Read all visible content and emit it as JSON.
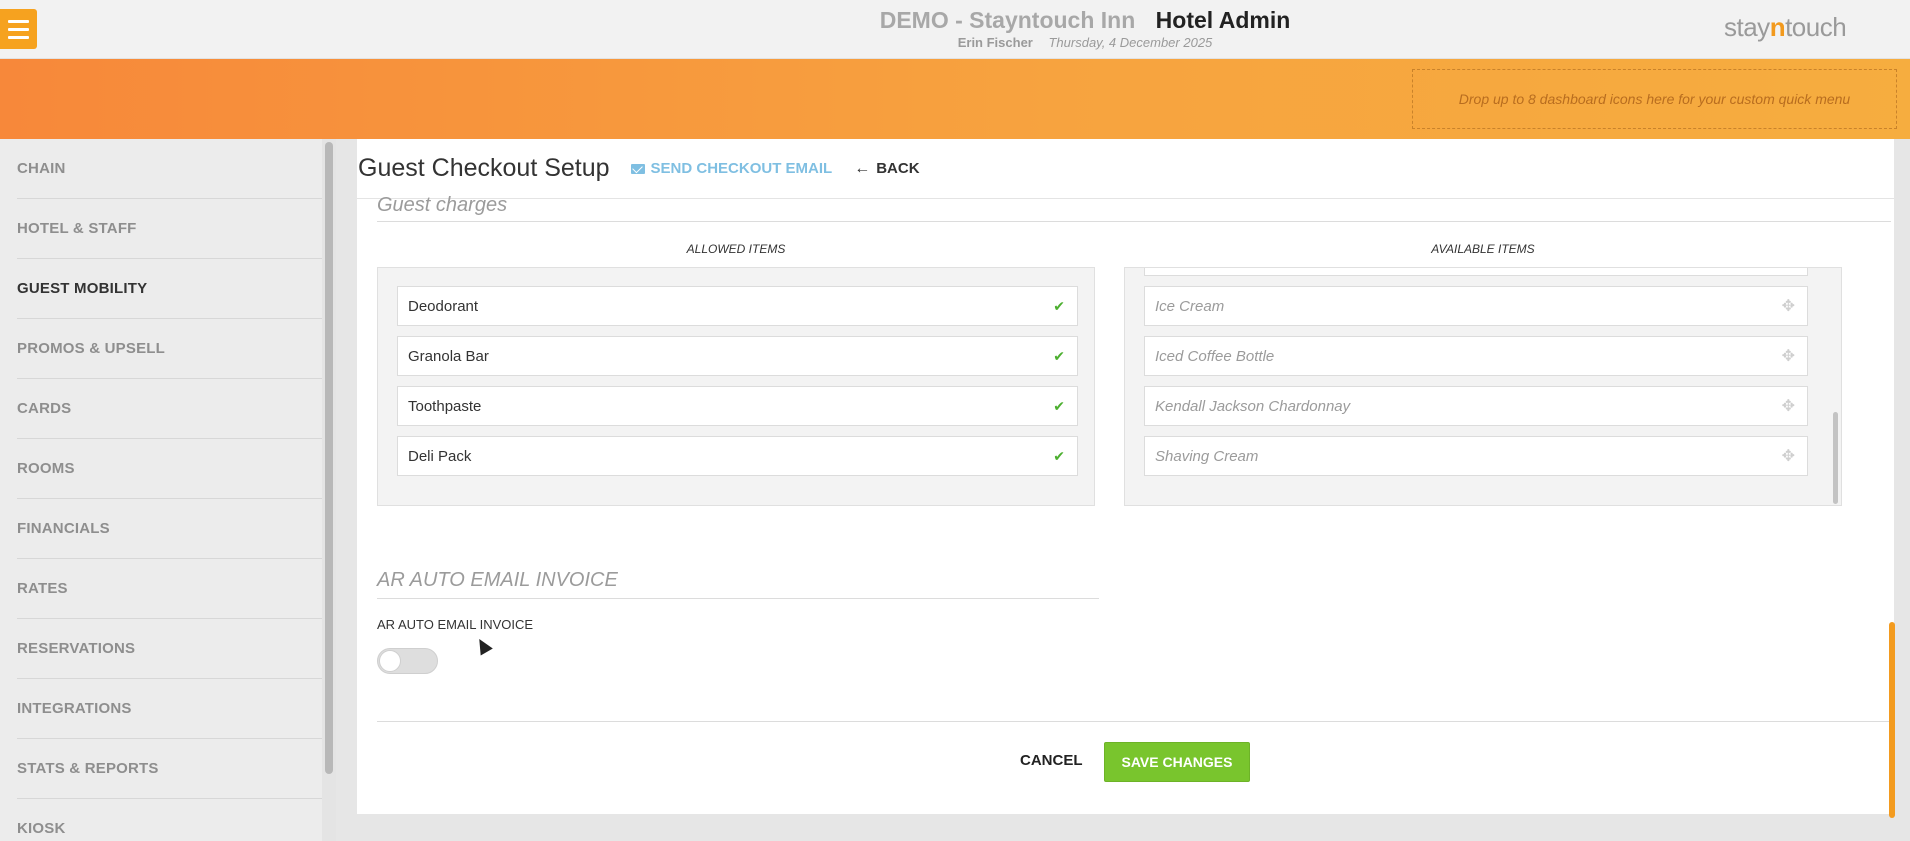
{
  "header": {
    "hotel_name": "DEMO - Stayntouch Inn",
    "app_title": "Hotel Admin",
    "user_name": "Erin Fischer",
    "date": "Thursday, 4 December 2025",
    "logo_prefix": "stay",
    "logo_n": "n",
    "logo_suffix": "touch",
    "dropzone_text": "Drop up to 8 dashboard icons here for your custom quick menu"
  },
  "sidebar": {
    "items": [
      {
        "label": "CHAIN"
      },
      {
        "label": "HOTEL & STAFF"
      },
      {
        "label": "GUEST MOBILITY",
        "active": true
      },
      {
        "label": "PROMOS & UPSELL"
      },
      {
        "label": "CARDS"
      },
      {
        "label": "ROOMS"
      },
      {
        "label": "FINANCIALS"
      },
      {
        "label": "RATES"
      },
      {
        "label": "RESERVATIONS"
      },
      {
        "label": "INTEGRATIONS"
      },
      {
        "label": "STATS & REPORTS"
      },
      {
        "label": "KIOSK"
      }
    ]
  },
  "page": {
    "title": "Guest Checkout Setup",
    "send_email_label": "SEND CHECKOUT EMAIL",
    "back_label": "BACK",
    "back_icon": "←"
  },
  "guest_charges": {
    "section_title": "Guest charges",
    "allowed_header": "ALLOWED ITEMS",
    "available_header": "AVAILABLE ITEMS",
    "allowed_items": [
      "Deodorant",
      "Granola Bar",
      "Toothpaste",
      "Deli Pack"
    ],
    "available_items": [
      "Ice Cream",
      "Iced Coffee Bottle",
      "Kendall Jackson Chardonnay",
      "Shaving Cream"
    ],
    "check_glyph": "✔",
    "move_glyph": "✥"
  },
  "ar_invoice": {
    "section_title": "AR AUTO EMAIL INVOICE",
    "toggle_label": "AR AUTO EMAIL INVOICE",
    "toggle_on": false
  },
  "footer": {
    "cancel_label": "CANCEL",
    "save_label": "SAVE CHANGES"
  },
  "colors": {
    "accent_orange": "#f6a21f",
    "save_green": "#79c52d",
    "link_blue": "#7fbfe2",
    "check_green": "#4caf2f"
  }
}
